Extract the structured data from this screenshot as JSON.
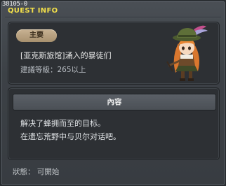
{
  "window": {
    "quest_id": "38105-0",
    "title": "QUEST INFO"
  },
  "quest": {
    "badge": "主要",
    "name": "[亚克斯旅馆]涌入的暴徒们",
    "level_requirement": "建議等級：265以上"
  },
  "content": {
    "header": "內容",
    "lines": [
      "解决了蜂拥而至的目标。",
      "在遗忘荒野中与贝尔对话吧。"
    ]
  },
  "status": {
    "text": "狀態：  可開始"
  },
  "colors": {
    "title_accent": "#f3e04a",
    "badge_bg": "#b8a07e",
    "panel_bg": "#2d3034"
  },
  "icons": {
    "npc_portrait": "npc-portrait-icon"
  }
}
